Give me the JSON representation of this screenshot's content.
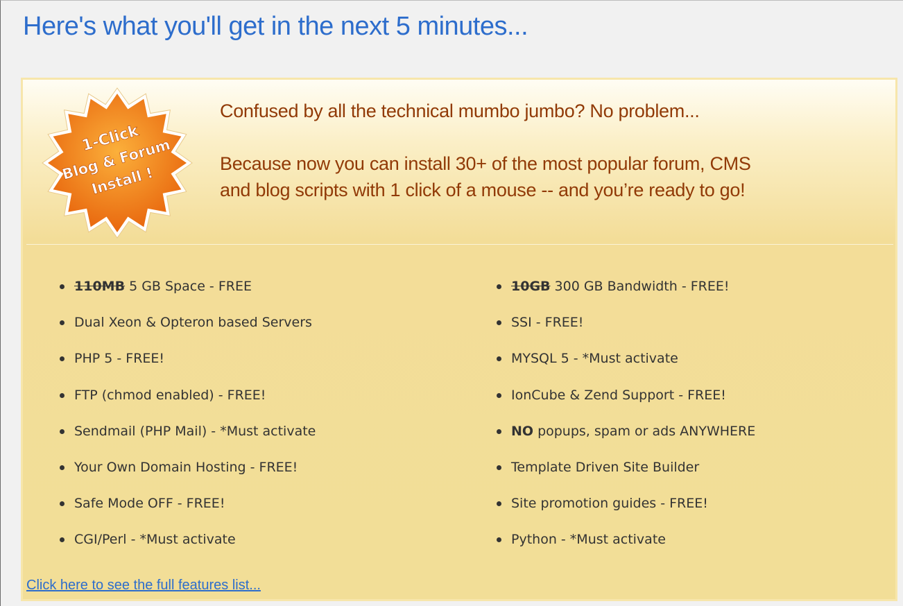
{
  "headline": "Here's what you'll get in the next 5 minutes...",
  "badge": {
    "icon": "starburst-badge-icon",
    "line1": "1-Click",
    "line2": "Blog & Forum",
    "line3": "Install !",
    "colors": {
      "fill": "#f07a12",
      "fill_light": "#fbb03b",
      "text": "#ffffff"
    }
  },
  "intro": {
    "line1": "Confused by all the technical mumbo jumbo? No problem...",
    "line2": "Because now you can install 30+ of the most popular forum, CMS",
    "line3": "and blog scripts with 1 click of a mouse -- and you’re ready to go!"
  },
  "features_left": [
    {
      "strike": "110MB",
      "text": "5 GB Space - FREE"
    },
    {
      "text": "Dual Xeon & Opteron based Servers"
    },
    {
      "text": "PHP 5 - FREE!"
    },
    {
      "text": "FTP (chmod enabled) - FREE!"
    },
    {
      "text": "Sendmail (PHP Mail) - *Must activate"
    },
    {
      "text": "Your Own Domain Hosting - FREE!"
    },
    {
      "text": "Safe Mode OFF - FREE!"
    },
    {
      "text": "CGI/Perl - *Must activate"
    }
  ],
  "features_right": [
    {
      "strike": "10GB",
      "text": "300 GB Bandwidth - FREE!"
    },
    {
      "text": "SSI - FREE!"
    },
    {
      "text": "MYSQL 5 - *Must activate"
    },
    {
      "text": "IonCube & Zend Support - FREE!"
    },
    {
      "bold": "NO",
      "text": "popups, spam or ads ANYWHERE"
    },
    {
      "text": "Template Driven Site Builder"
    },
    {
      "text": "Site promotion guides - FREE!"
    },
    {
      "text": "Python - *Must activate"
    }
  ],
  "features_link": "Click here to see the full features list...",
  "colors": {
    "headline": "#2d6dcc",
    "intro_text": "#913a07",
    "panel_bg": "#f2de97",
    "panel_border": "#f7e6ab",
    "link": "#2d6dcc"
  }
}
